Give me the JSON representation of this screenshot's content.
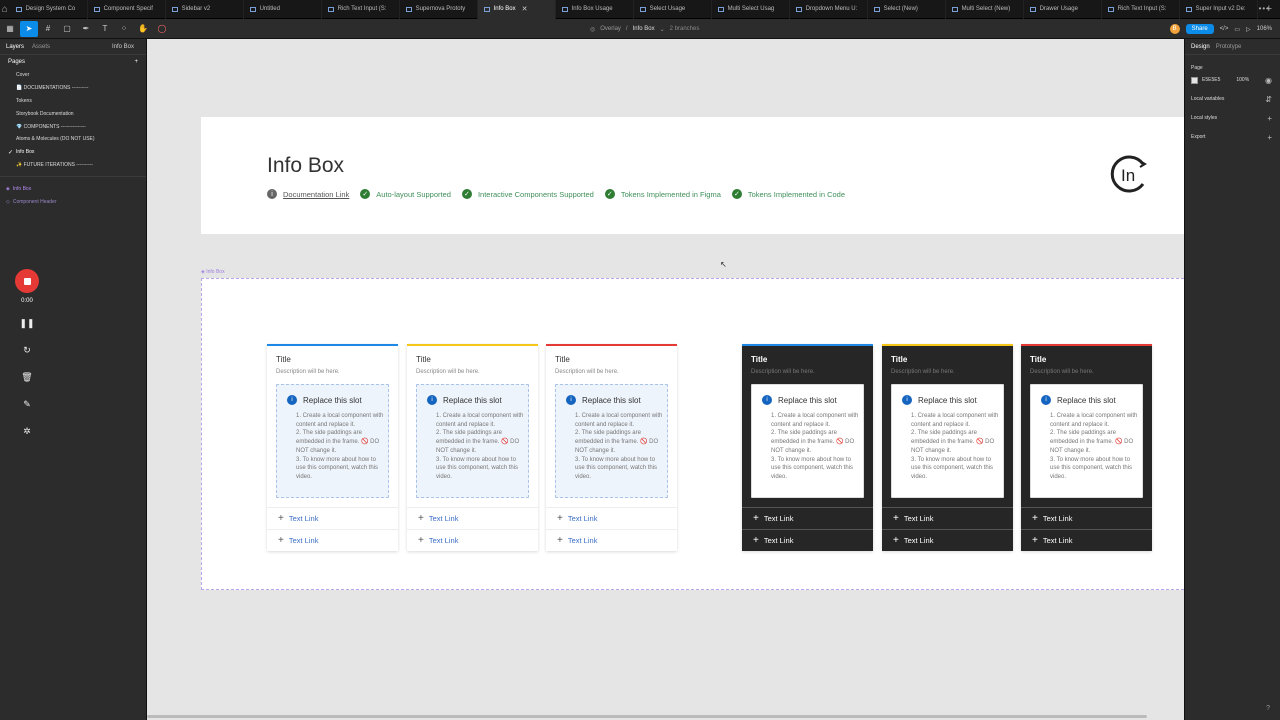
{
  "tabs": [
    "Design System Co",
    "Component Specif",
    "Sidebar v2",
    "Untitled",
    "Rich Text Input (S:",
    "Supernova Prototy",
    "Info Box",
    "Info Box Usage",
    "Select Usage",
    "Multi Select Usag",
    "Dropdown Menu U:",
    "Select (New)",
    "Multi Select (New)",
    "Drawer Usage",
    "Rich Text Input (S:",
    "Super Input v2 De:"
  ],
  "toolbar": {
    "breadcrumb_parent": "Overlay",
    "breadcrumb_current": "Info Box",
    "branches": "2 branches",
    "avatar_initial": "B",
    "share_label": "Share",
    "zoom": "106%"
  },
  "left_panel": {
    "tab_layers": "Layers",
    "tab_assets": "Assets",
    "page_selector": "Info Box",
    "pages_title": "Pages",
    "pages": [
      "Cover",
      "📄 DOCUMENTATIONS ----------",
      "Tokens",
      "Storybook Documentation",
      "💎 COMPONENTS ---------------",
      "Atoms & Molecules (DO NOT USE)",
      "Info Box",
      "✨ FUTURE ITERATIONS ----------"
    ],
    "layers": [
      "Info Box",
      "Component Header"
    ]
  },
  "recorder": {
    "time": "0:00"
  },
  "header": {
    "title": "Info Box",
    "features": [
      "Documentation Link",
      "Auto-layout Supported",
      "Interactive Components Supported",
      "Tokens Implemented in Figma",
      "Tokens Implemented in Code"
    ]
  },
  "frame_label": "Info Box",
  "cards": [
    {
      "title": "Title",
      "desc": "Description will be here.",
      "accent": "#1e88e5",
      "theme": "light"
    },
    {
      "title": "Title",
      "desc": "Description will be here.",
      "accent": "#f5c518",
      "theme": "light"
    },
    {
      "title": "Title",
      "desc": "Description will be here.",
      "accent": "#e53935",
      "theme": "light"
    },
    {
      "title": "Title",
      "desc": "Description will be here.",
      "accent": "#1e88e5",
      "theme": "dark"
    },
    {
      "title": "Title",
      "desc": "Description will be here.",
      "accent": "#f5c518",
      "theme": "dark"
    },
    {
      "title": "Title",
      "desc": "Description will be here.",
      "accent": "#e53935",
      "theme": "dark"
    }
  ],
  "slot": {
    "heading": "Replace this slot",
    "steps": [
      "1. Create a local component with content and replace it.",
      "2. The side paddings are embedded in the frame. 🚫 DO NOT change it.",
      "3. To know more about how to use this component, watch this video."
    ]
  },
  "link_label": "Text Link",
  "right_panel": {
    "tab_design": "Design",
    "tab_prototype": "Prototype",
    "page_label": "Page",
    "page_color": "E5E5E5",
    "page_opacity": "100%",
    "local_variables": "Local variables",
    "local_styles": "Local styles",
    "export": "Export"
  }
}
